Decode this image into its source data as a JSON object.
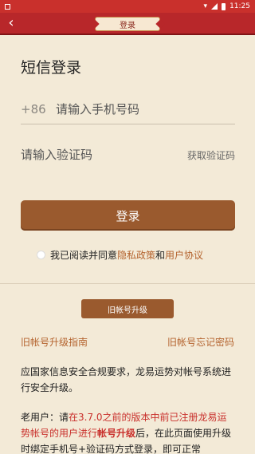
{
  "status_bar": {
    "time": "11:25",
    "app_icon": "app-notification-icon",
    "wifi_icon": "wifi-icon",
    "signal_icon": "signal-icon",
    "battery_icon": "battery-icon"
  },
  "header": {
    "back_icon": "chevron-left-icon",
    "back_glyph": "‹",
    "title": "登录"
  },
  "login": {
    "page_title": "短信登录",
    "country_code": "+86",
    "phone_placeholder": "请输入手机号码",
    "code_placeholder": "请输入验证码",
    "get_code_label": "获取验证码",
    "submit_label": "登录"
  },
  "agreement": {
    "prefix": "我已阅读并同意",
    "privacy_link": "隐私政策",
    "conjunction": "和",
    "terms_link": "用户协议"
  },
  "legacy": {
    "upgrade_button": "旧帐号升级",
    "guide_link": "旧帐号升级指南",
    "forgot_link": "旧帐号忘记密码"
  },
  "notice": {
    "line1": "应国家信息安全合规要求，龙易运势对帐号系统进行安全升级。",
    "p2_prefix": "老用户：请",
    "p2_red": "在3.7.0之前的版本中前已注册龙易运势帐号的用户进行",
    "p2_bold": "帐号升级",
    "p2_suffix": "后，在此页面使用升级时绑定手机号+验证码方式登录，即可正常"
  },
  "colors": {
    "brand_red": "#c9302c",
    "button_brown": "#9a5a2e",
    "link_brown": "#b4632e",
    "background": "#f3ead7"
  }
}
